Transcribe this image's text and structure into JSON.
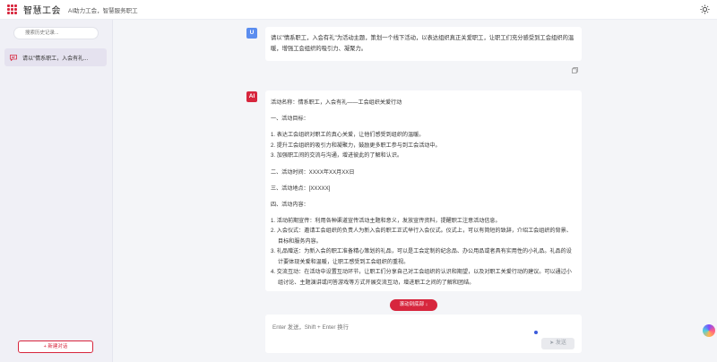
{
  "header": {
    "title": "智慧工会",
    "subtitle": "AI助力工会，智慧服务职工"
  },
  "sidebar": {
    "search_placeholder": "搜索历史记录...",
    "history": [
      {
        "label": "请以\"情系职工，入会有礼..."
      }
    ],
    "new_chat_label": "+ 新建对话"
  },
  "conversation": {
    "user": {
      "avatar": "U",
      "text": "请以\"情系职工，入会有礼\"为活动主题，策划一个线下活动，以表达组织真正关爱职工，让职工们充分感受到工会组织的温暖，增强工会组织的吸引力、凝聚力。"
    },
    "ai": {
      "avatar": "AI",
      "activity_name": "活动名称：情系职工，入会有礼——工会组织关爱行动",
      "goal_heading": "一、活动目标：",
      "goals": [
        "1. 表达工会组织对职工的真心关爱，让他们感受到组织的温暖。",
        "2. 提升工会组织的吸引力和凝聚力，鼓励更多职工参与到工会活动中。",
        "3. 加强职工间的交流与沟通，增进彼此的了解和认识。"
      ],
      "time": "二、活动时间：XXXX年XX月XX日",
      "place": "三、活动地点：[XXXXX]",
      "content_heading": "四、活动内容：",
      "contents": [
        "1. 活动前期宣传：利用各种渠道宣传活动主题和意义，发放宣传资料，提醒职工注意活动信息。",
        "2. 入会仪式：邀请工会组织的负责人为新入会的职工正式举行入会仪式。仪式上，可以有简短的致辞，介绍工会组织的背景、目标和服务内容。",
        "3. 礼品赠送：为新入会的职工准备精心策划的礼品，可以是工会定制的纪念品、办公用品或者具有实用性的小礼品。礼品的设计要体现关爱和温暖，让职工感受到工会组织的重视。",
        "4. 交流互动：在活动中设置互动环节，让职工们分享自己对工会组织的认识和期望，以及对职工关爱行动的建议。可以通过小组讨论、主题演讲或问答游戏等方式开展交流互动，增进职工之间的了解和团结。"
      ]
    }
  },
  "scroll_bottom_label": "滚动到底部 ↓",
  "composer": {
    "placeholder": "Enter 发送，Shift + Enter 换行",
    "send_label": "发送"
  },
  "colors": {
    "brand": "#d7263d",
    "user_avatar": "#5b8def"
  },
  "icons": [
    "logo-icon",
    "theme-toggle-icon",
    "chat-icon",
    "copy-icon",
    "send-icon",
    "assistant-icon"
  ]
}
